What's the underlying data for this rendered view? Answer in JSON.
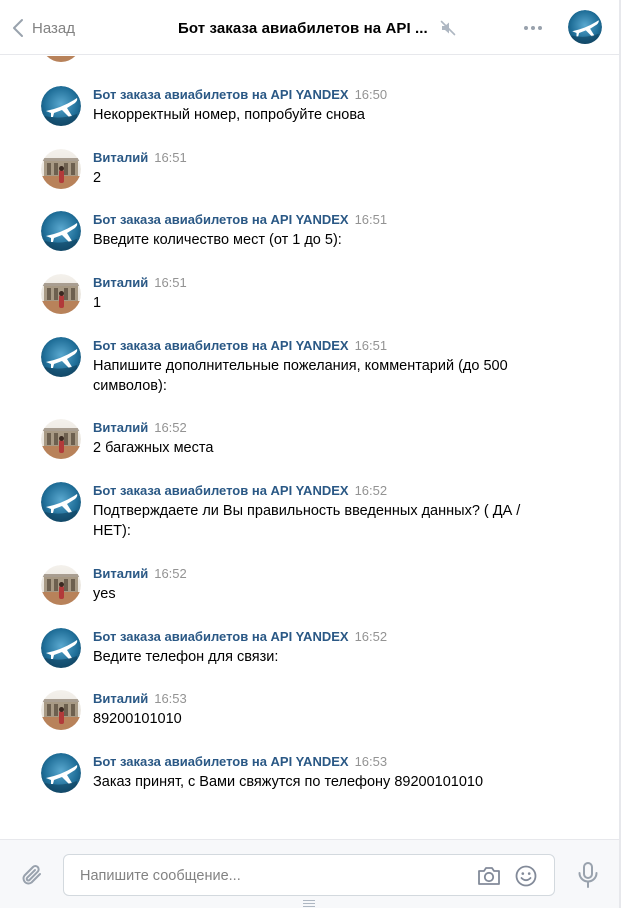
{
  "header": {
    "back_label": "Назад",
    "title": "Бот заказа авиабилетов на API ...",
    "icons": [
      "chevron-left-icon",
      "muted-speaker-icon",
      "more-dots-icon"
    ]
  },
  "composer": {
    "placeholder": "Напишите сообщение...",
    "icons": [
      "paperclip-icon",
      "camera-icon",
      "smile-icon",
      "microphone-icon"
    ]
  },
  "colors": {
    "author": "#2a5885",
    "time": "#939393",
    "muted_text": "#828282",
    "border": "#e7e8ec",
    "composer_bg": "#f7f8fa"
  },
  "messages": [
    {
      "author": "Бот заказа авиабилетов на API YANDEX",
      "time": "16:50",
      "text": "Некорректный номер, попробуйте снова",
      "kind": "bot"
    },
    {
      "author": "Виталий",
      "time": "16:51",
      "text": "2",
      "kind": "user"
    },
    {
      "author": "Бот заказа авиабилетов на API YANDEX",
      "time": "16:51",
      "text": "Введите количество мест (от 1 до 5):",
      "kind": "bot"
    },
    {
      "author": "Виталий",
      "time": "16:51",
      "text": "1",
      "kind": "user"
    },
    {
      "author": "Бот заказа авиабилетов на API YANDEX",
      "time": "16:51",
      "text": "Напишите дополнительные пожелания, комментарий (до 500 символов):",
      "kind": "bot"
    },
    {
      "author": "Виталий",
      "time": "16:52",
      "text": "2 багажных места",
      "kind": "user"
    },
    {
      "author": "Бот заказа авиабилетов на API YANDEX",
      "time": "16:52",
      "text": "Подтверждаете ли Вы правильность введенных данных? ( ДА / НЕТ):",
      "kind": "bot"
    },
    {
      "author": "Виталий",
      "time": "16:52",
      "text": "yes",
      "kind": "user"
    },
    {
      "author": "Бот заказа авиабилетов на API YANDEX",
      "time": "16:52",
      "text": "Ведите телефон для связи:",
      "kind": "bot"
    },
    {
      "author": "Виталий",
      "time": "16:53",
      "text": "89200101010",
      "kind": "user"
    },
    {
      "author": "Бот заказа авиабилетов на API YANDEX",
      "time": "16:53",
      "text": "Заказ принят, с Вами свяжутся по телефону 89200101010",
      "kind": "bot"
    }
  ]
}
